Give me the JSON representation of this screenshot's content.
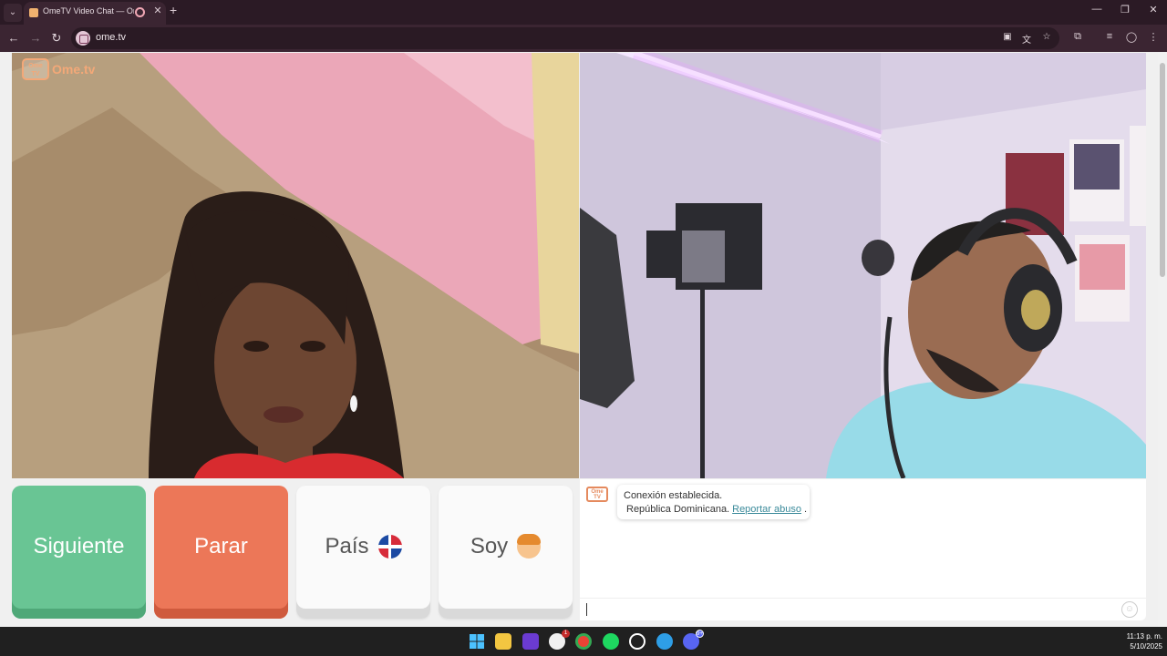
{
  "browser": {
    "tab_title": "OmeTV Video Chat — Ome.tv",
    "url": "ome.tv",
    "new_tab": "+",
    "close": "✕",
    "minimize": "—",
    "restore": "❐",
    "window_close": "✕"
  },
  "page": {
    "logo_small": "Ome TV",
    "logo_text": "Ome.tv"
  },
  "controls": {
    "next_label": "Siguiente",
    "stop_label": "Parar",
    "country_label": "País",
    "gender_label": "Soy"
  },
  "chat": {
    "logo": "Ome TV",
    "connection_message": "Conexión establecida.",
    "country_name": "República Dominicana.",
    "report_link": "Reportar abuso",
    "report_suffix": "."
  },
  "taskbar": {
    "time": "11:13 p. m.",
    "date": "5/10/2025",
    "xbox_badge": "1",
    "discord_badge": "9+"
  },
  "colors": {
    "next": "#69c594",
    "stop": "#ec7758",
    "accent": "#f3a878"
  },
  "icons": [
    "back-icon",
    "forward-icon",
    "reload-icon",
    "site-info-icon",
    "cast-icon",
    "translate-icon",
    "star-icon",
    "extensions-icon",
    "media-icon",
    "profile-icon",
    "menu-icon",
    "emoji-icon",
    "windows-start-icon",
    "file-explorer-icon",
    "instagram-icon",
    "xbox-icon",
    "chrome-icon",
    "spotify-icon",
    "github-icon",
    "edge-icon",
    "discord-icon"
  ]
}
